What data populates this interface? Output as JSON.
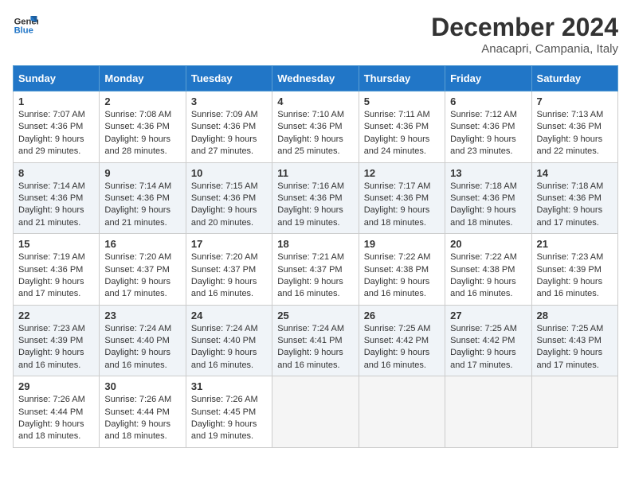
{
  "header": {
    "logo_line1": "General",
    "logo_line2": "Blue",
    "title": "December 2024",
    "subtitle": "Anacapri, Campania, Italy"
  },
  "days_of_week": [
    "Sunday",
    "Monday",
    "Tuesday",
    "Wednesday",
    "Thursday",
    "Friday",
    "Saturday"
  ],
  "weeks": [
    [
      {
        "day": "1",
        "sunrise": "Sunrise: 7:07 AM",
        "sunset": "Sunset: 4:36 PM",
        "daylight": "Daylight: 9 hours and 29 minutes."
      },
      {
        "day": "2",
        "sunrise": "Sunrise: 7:08 AM",
        "sunset": "Sunset: 4:36 PM",
        "daylight": "Daylight: 9 hours and 28 minutes."
      },
      {
        "day": "3",
        "sunrise": "Sunrise: 7:09 AM",
        "sunset": "Sunset: 4:36 PM",
        "daylight": "Daylight: 9 hours and 27 minutes."
      },
      {
        "day": "4",
        "sunrise": "Sunrise: 7:10 AM",
        "sunset": "Sunset: 4:36 PM",
        "daylight": "Daylight: 9 hours and 25 minutes."
      },
      {
        "day": "5",
        "sunrise": "Sunrise: 7:11 AM",
        "sunset": "Sunset: 4:36 PM",
        "daylight": "Daylight: 9 hours and 24 minutes."
      },
      {
        "day": "6",
        "sunrise": "Sunrise: 7:12 AM",
        "sunset": "Sunset: 4:36 PM",
        "daylight": "Daylight: 9 hours and 23 minutes."
      },
      {
        "day": "7",
        "sunrise": "Sunrise: 7:13 AM",
        "sunset": "Sunset: 4:36 PM",
        "daylight": "Daylight: 9 hours and 22 minutes."
      }
    ],
    [
      {
        "day": "8",
        "sunrise": "Sunrise: 7:14 AM",
        "sunset": "Sunset: 4:36 PM",
        "daylight": "Daylight: 9 hours and 21 minutes."
      },
      {
        "day": "9",
        "sunrise": "Sunrise: 7:14 AM",
        "sunset": "Sunset: 4:36 PM",
        "daylight": "Daylight: 9 hours and 21 minutes."
      },
      {
        "day": "10",
        "sunrise": "Sunrise: 7:15 AM",
        "sunset": "Sunset: 4:36 PM",
        "daylight": "Daylight: 9 hours and 20 minutes."
      },
      {
        "day": "11",
        "sunrise": "Sunrise: 7:16 AM",
        "sunset": "Sunset: 4:36 PM",
        "daylight": "Daylight: 9 hours and 19 minutes."
      },
      {
        "day": "12",
        "sunrise": "Sunrise: 7:17 AM",
        "sunset": "Sunset: 4:36 PM",
        "daylight": "Daylight: 9 hours and 18 minutes."
      },
      {
        "day": "13",
        "sunrise": "Sunrise: 7:18 AM",
        "sunset": "Sunset: 4:36 PM",
        "daylight": "Daylight: 9 hours and 18 minutes."
      },
      {
        "day": "14",
        "sunrise": "Sunrise: 7:18 AM",
        "sunset": "Sunset: 4:36 PM",
        "daylight": "Daylight: 9 hours and 17 minutes."
      }
    ],
    [
      {
        "day": "15",
        "sunrise": "Sunrise: 7:19 AM",
        "sunset": "Sunset: 4:36 PM",
        "daylight": "Daylight: 9 hours and 17 minutes."
      },
      {
        "day": "16",
        "sunrise": "Sunrise: 7:20 AM",
        "sunset": "Sunset: 4:37 PM",
        "daylight": "Daylight: 9 hours and 17 minutes."
      },
      {
        "day": "17",
        "sunrise": "Sunrise: 7:20 AM",
        "sunset": "Sunset: 4:37 PM",
        "daylight": "Daylight: 9 hours and 16 minutes."
      },
      {
        "day": "18",
        "sunrise": "Sunrise: 7:21 AM",
        "sunset": "Sunset: 4:37 PM",
        "daylight": "Daylight: 9 hours and 16 minutes."
      },
      {
        "day": "19",
        "sunrise": "Sunrise: 7:22 AM",
        "sunset": "Sunset: 4:38 PM",
        "daylight": "Daylight: 9 hours and 16 minutes."
      },
      {
        "day": "20",
        "sunrise": "Sunrise: 7:22 AM",
        "sunset": "Sunset: 4:38 PM",
        "daylight": "Daylight: 9 hours and 16 minutes."
      },
      {
        "day": "21",
        "sunrise": "Sunrise: 7:23 AM",
        "sunset": "Sunset: 4:39 PM",
        "daylight": "Daylight: 9 hours and 16 minutes."
      }
    ],
    [
      {
        "day": "22",
        "sunrise": "Sunrise: 7:23 AM",
        "sunset": "Sunset: 4:39 PM",
        "daylight": "Daylight: 9 hours and 16 minutes."
      },
      {
        "day": "23",
        "sunrise": "Sunrise: 7:24 AM",
        "sunset": "Sunset: 4:40 PM",
        "daylight": "Daylight: 9 hours and 16 minutes."
      },
      {
        "day": "24",
        "sunrise": "Sunrise: 7:24 AM",
        "sunset": "Sunset: 4:40 PM",
        "daylight": "Daylight: 9 hours and 16 minutes."
      },
      {
        "day": "25",
        "sunrise": "Sunrise: 7:24 AM",
        "sunset": "Sunset: 4:41 PM",
        "daylight": "Daylight: 9 hours and 16 minutes."
      },
      {
        "day": "26",
        "sunrise": "Sunrise: 7:25 AM",
        "sunset": "Sunset: 4:42 PM",
        "daylight": "Daylight: 9 hours and 16 minutes."
      },
      {
        "day": "27",
        "sunrise": "Sunrise: 7:25 AM",
        "sunset": "Sunset: 4:42 PM",
        "daylight": "Daylight: 9 hours and 17 minutes."
      },
      {
        "day": "28",
        "sunrise": "Sunrise: 7:25 AM",
        "sunset": "Sunset: 4:43 PM",
        "daylight": "Daylight: 9 hours and 17 minutes."
      }
    ],
    [
      {
        "day": "29",
        "sunrise": "Sunrise: 7:26 AM",
        "sunset": "Sunset: 4:44 PM",
        "daylight": "Daylight: 9 hours and 18 minutes."
      },
      {
        "day": "30",
        "sunrise": "Sunrise: 7:26 AM",
        "sunset": "Sunset: 4:44 PM",
        "daylight": "Daylight: 9 hours and 18 minutes."
      },
      {
        "day": "31",
        "sunrise": "Sunrise: 7:26 AM",
        "sunset": "Sunset: 4:45 PM",
        "daylight": "Daylight: 9 hours and 19 minutes."
      },
      null,
      null,
      null,
      null
    ]
  ]
}
